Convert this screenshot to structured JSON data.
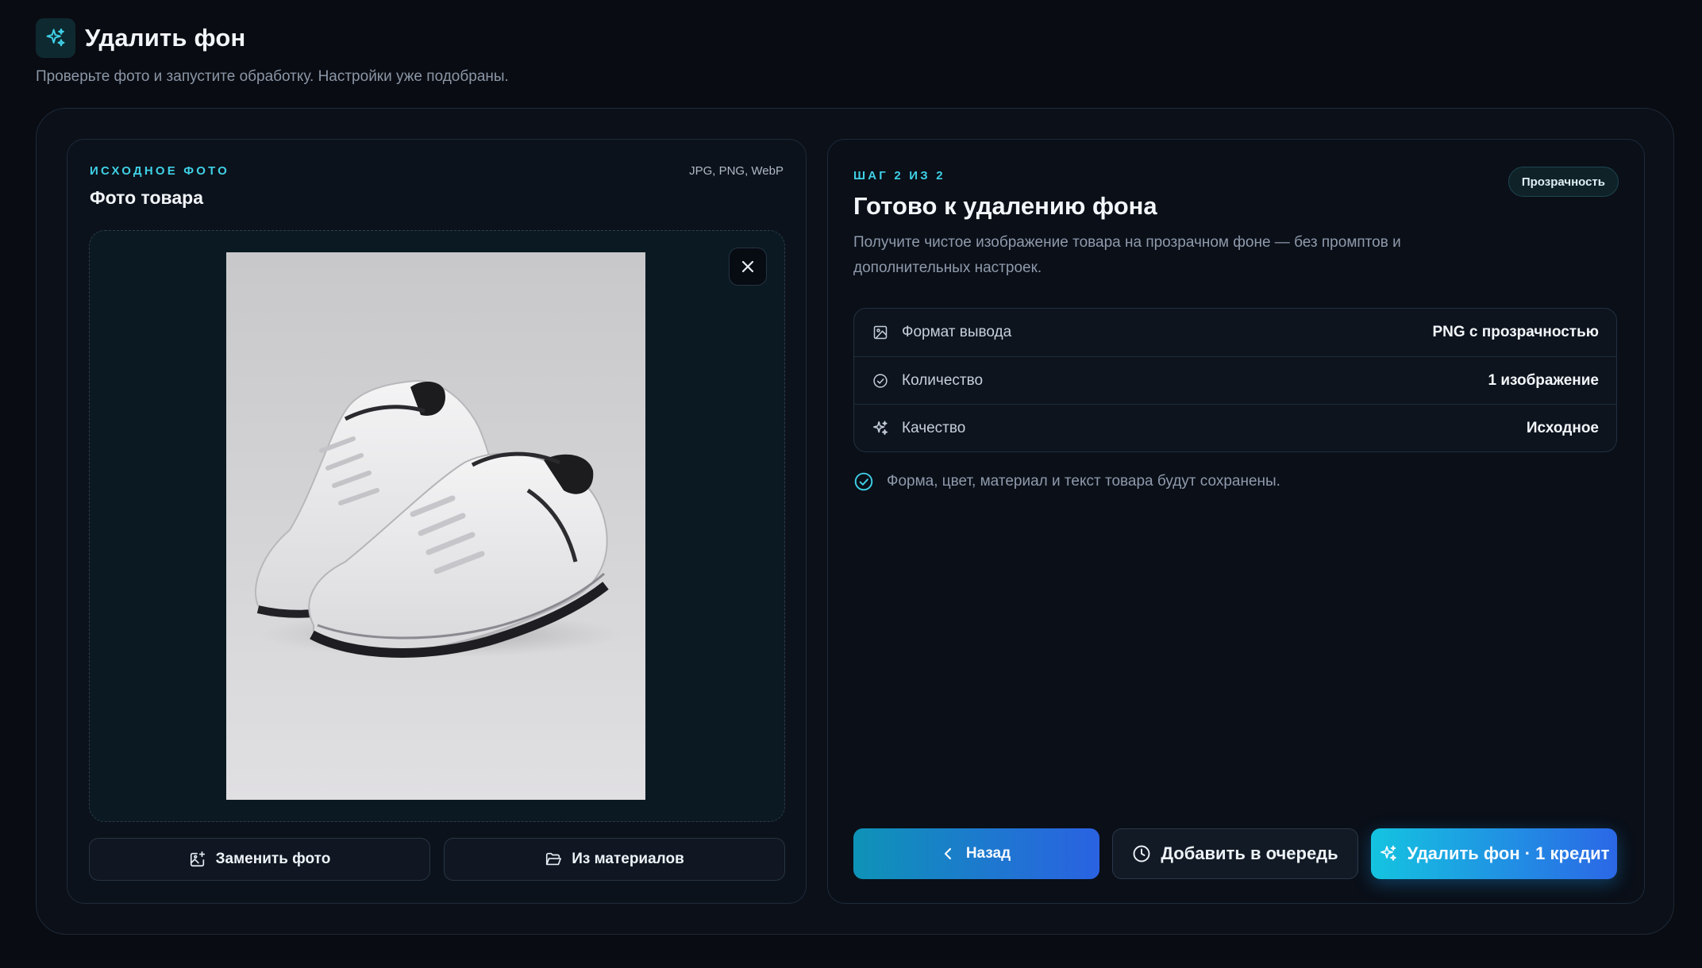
{
  "header": {
    "title": "Удалить фон",
    "subtitle": "Проверьте фото и запустите обработку. Настройки уже подобраны.",
    "icon": "sparkles-icon"
  },
  "left_card": {
    "overline": "ИСХОДНОЕ ФОТО",
    "formats": "JPG, PNG, WebP",
    "title": "Фото товара",
    "photo_subject": "white sneakers photo",
    "close_icon": "close-icon",
    "replace_label": "Заменить фото",
    "materials_label": "Из материалов"
  },
  "right_card": {
    "step": "ШАГ 2 ИЗ 2",
    "badge": "Прозрачность",
    "title": "Готово к удалению фона",
    "description": "Получите чистое изображение товара на прозрачном фоне — без промптов и дополнительных настроек.",
    "settings": [
      {
        "icon": "image-icon",
        "label": "Формат вывода",
        "value": "PNG с прозрачностью"
      },
      {
        "icon": "check-circle-icon",
        "label": "Количество",
        "value": "1 изображение"
      },
      {
        "icon": "sparkles-icon",
        "label": "Качество",
        "value": "Исходное"
      }
    ],
    "note": "Форма, цвет, материал и текст товара будут сохранены.",
    "back_label": "Назад",
    "queue_label": "Добавить в очередь",
    "remove_label": "Удалить фон · 1 кредит"
  },
  "colors": {
    "accent": "#3fd0e6",
    "background": "#090c12",
    "gradient_start": "#14c4e0",
    "gradient_end": "#2b67e6"
  }
}
